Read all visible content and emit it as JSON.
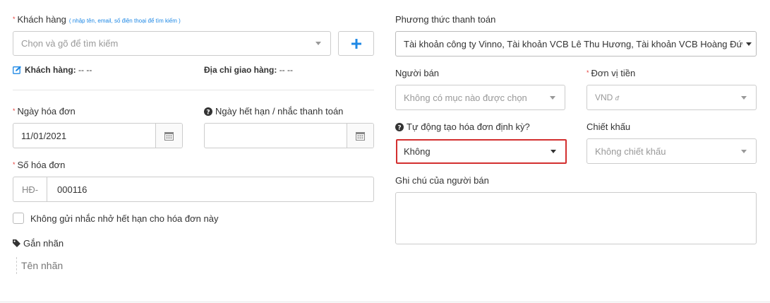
{
  "customer": {
    "label": "Khách hàng",
    "hint": "( nhập tên, email, số điện thoại để tìm kiếm )",
    "placeholder": "Chọn và gõ để tìm kiếm",
    "info_label": "Khách hàng:",
    "info_value": "-- --",
    "address_label": "Địa chỉ giao hàng:",
    "address_value": "-- --"
  },
  "invoice_date": {
    "label": "Ngày hóa đơn",
    "value": "11/01/2021"
  },
  "due_date": {
    "label": "Ngày hết hạn / nhắc thanh toán",
    "value": ""
  },
  "invoice_number": {
    "label": "Số hóa đơn",
    "prefix": "HĐ-",
    "value": "000116"
  },
  "no_reminder": {
    "label": "Không gửi nhắc nhở hết hạn cho hóa đơn này",
    "checked": false
  },
  "tags": {
    "label": "Gắn nhãn",
    "placeholder": "Tên nhãn"
  },
  "payment_method": {
    "label": "Phương thức thanh toán",
    "value": "Tài khoản công ty Vinno, Tài khoản VCB Lê Thu Hương, Tài khoản VCB Hoàng Đức L"
  },
  "seller": {
    "label": "Người bán",
    "placeholder": "Không có mục nào được chọn"
  },
  "currency": {
    "label": "Đơn vị tiền",
    "value": "VND",
    "symbol": "đ"
  },
  "recurring": {
    "label": "Tự động tạo hóa đơn định kỳ?",
    "value": "Không"
  },
  "discount": {
    "label": "Chiết khấu",
    "placeholder": "Không chiết khấu"
  },
  "seller_note": {
    "label": "Ghi chú của người bán",
    "value": ""
  },
  "colors": {
    "accent": "#1e88e5",
    "required": "#e53935",
    "highlight": "#d32f2f"
  }
}
